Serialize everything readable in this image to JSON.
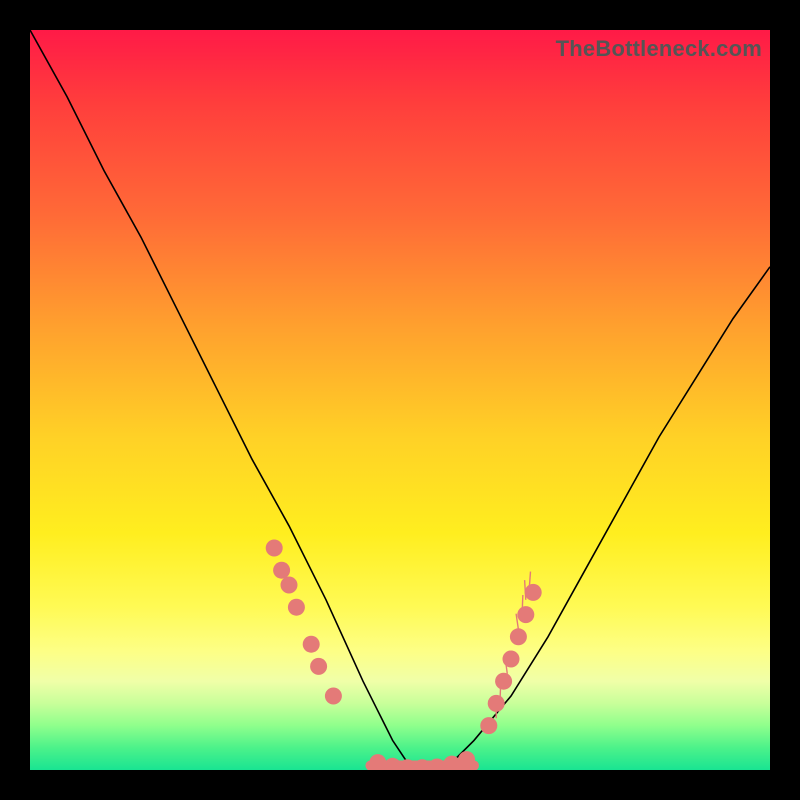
{
  "watermark": "TheBottleneck.com",
  "colors": {
    "dot": "#e47a78",
    "curve": "#000000",
    "gradient_top": "#ff1a47",
    "gradient_bottom": "#19e492",
    "frame": "#000000"
  },
  "chart_data": {
    "type": "line",
    "title": "",
    "xlabel": "",
    "ylabel": "",
    "xlim": [
      0,
      100
    ],
    "ylim": [
      0,
      100
    ],
    "series": [
      {
        "name": "bottleneck-curve",
        "x": [
          0,
          5,
          10,
          15,
          20,
          25,
          30,
          35,
          40,
          45,
          47,
          49,
          51,
          53,
          55,
          57,
          60,
          65,
          70,
          75,
          80,
          85,
          90,
          95,
          100
        ],
        "y": [
          100,
          91,
          81,
          72,
          62,
          52,
          42,
          33,
          23,
          12,
          8,
          4,
          1,
          0,
          0,
          1,
          4,
          10,
          18,
          27,
          36,
          45,
          53,
          61,
          68
        ]
      }
    ],
    "markers": [
      {
        "name": "left-cluster",
        "points": [
          [
            33,
            30
          ],
          [
            34,
            27
          ],
          [
            35,
            25
          ],
          [
            36,
            22
          ],
          [
            38,
            17
          ],
          [
            39,
            14
          ],
          [
            41,
            10
          ]
        ]
      },
      {
        "name": "floor-cluster",
        "points": [
          [
            47,
            1
          ],
          [
            49,
            0.5
          ],
          [
            51,
            0.3
          ],
          [
            53,
            0.3
          ],
          [
            55,
            0.4
          ],
          [
            57,
            0.8
          ],
          [
            59,
            1.4
          ]
        ]
      },
      {
        "name": "right-cluster",
        "points": [
          [
            62,
            6
          ],
          [
            63,
            9
          ],
          [
            64,
            12
          ],
          [
            65,
            15
          ],
          [
            66,
            18
          ],
          [
            67,
            21
          ],
          [
            68,
            24
          ]
        ]
      }
    ],
    "floor_segment": {
      "x0": 46,
      "x1": 60,
      "y": 0.6
    }
  }
}
